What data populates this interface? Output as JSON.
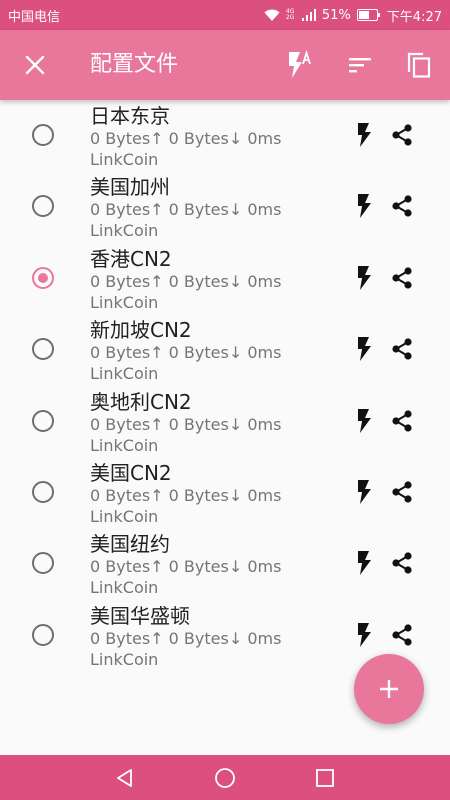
{
  "statusbar": {
    "carrier": "中国电信",
    "network": "4G 2G",
    "battery": "51%",
    "time": "下午4:27"
  },
  "appbar": {
    "title": "配置文件",
    "close_icon": "close-icon",
    "actions": [
      "flash-auto-icon",
      "sort-icon",
      "copy-icon"
    ]
  },
  "profiles": [
    {
      "name": "日本东京",
      "traffic": "0 Bytes↑  0 Bytes↓  0ms",
      "group": "LinkCoin",
      "selected": false
    },
    {
      "name": "美国加州",
      "traffic": "0 Bytes↑  0 Bytes↓  0ms",
      "group": "LinkCoin",
      "selected": false
    },
    {
      "name": "香港CN2",
      "traffic": "0 Bytes↑  0 Bytes↓  0ms",
      "group": "LinkCoin",
      "selected": true
    },
    {
      "name": "新加坡CN2",
      "traffic": "0 Bytes↑  0 Bytes↓  0ms",
      "group": "LinkCoin",
      "selected": false
    },
    {
      "name": "奥地利CN2",
      "traffic": "0 Bytes↑  0 Bytes↓  0ms",
      "group": "LinkCoin",
      "selected": false
    },
    {
      "name": "美国CN2",
      "traffic": "0 Bytes↑  0 Bytes↓  0ms",
      "group": "LinkCoin",
      "selected": false
    },
    {
      "name": "美国纽约",
      "traffic": "0 Bytes↑  0 Bytes↓  0ms",
      "group": "LinkCoin",
      "selected": false
    },
    {
      "name": "美国华盛顿",
      "traffic": "0 Bytes↑  0 Bytes↓  0ms",
      "group": "LinkCoin",
      "selected": false
    }
  ],
  "fab_icon": "add-icon",
  "navbar": [
    "back-icon",
    "home-icon",
    "recents-icon"
  ],
  "colors": {
    "accent": "#e8779b",
    "statusbar": "#db507f",
    "navbar": "#db507f"
  }
}
